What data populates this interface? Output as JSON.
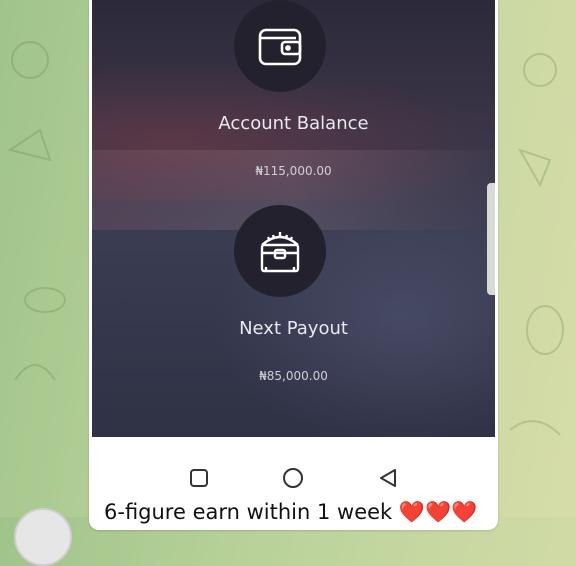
{
  "card_balance": {
    "label": "Account Balance",
    "amount": "₦115,000.00",
    "icon": "wallet-icon"
  },
  "card_payout": {
    "label": "Next Payout",
    "amount": "₦85,000.00",
    "icon": "treasure-chest-icon"
  },
  "nav": {
    "buttons": [
      "recent-apps",
      "home",
      "back"
    ]
  },
  "message": {
    "caption": "6-figure earn within 1 week",
    "emoji": "❤️❤️❤️"
  },
  "colors": {
    "accent_heart": "#e53935",
    "screen_bg": "#2f3145"
  }
}
